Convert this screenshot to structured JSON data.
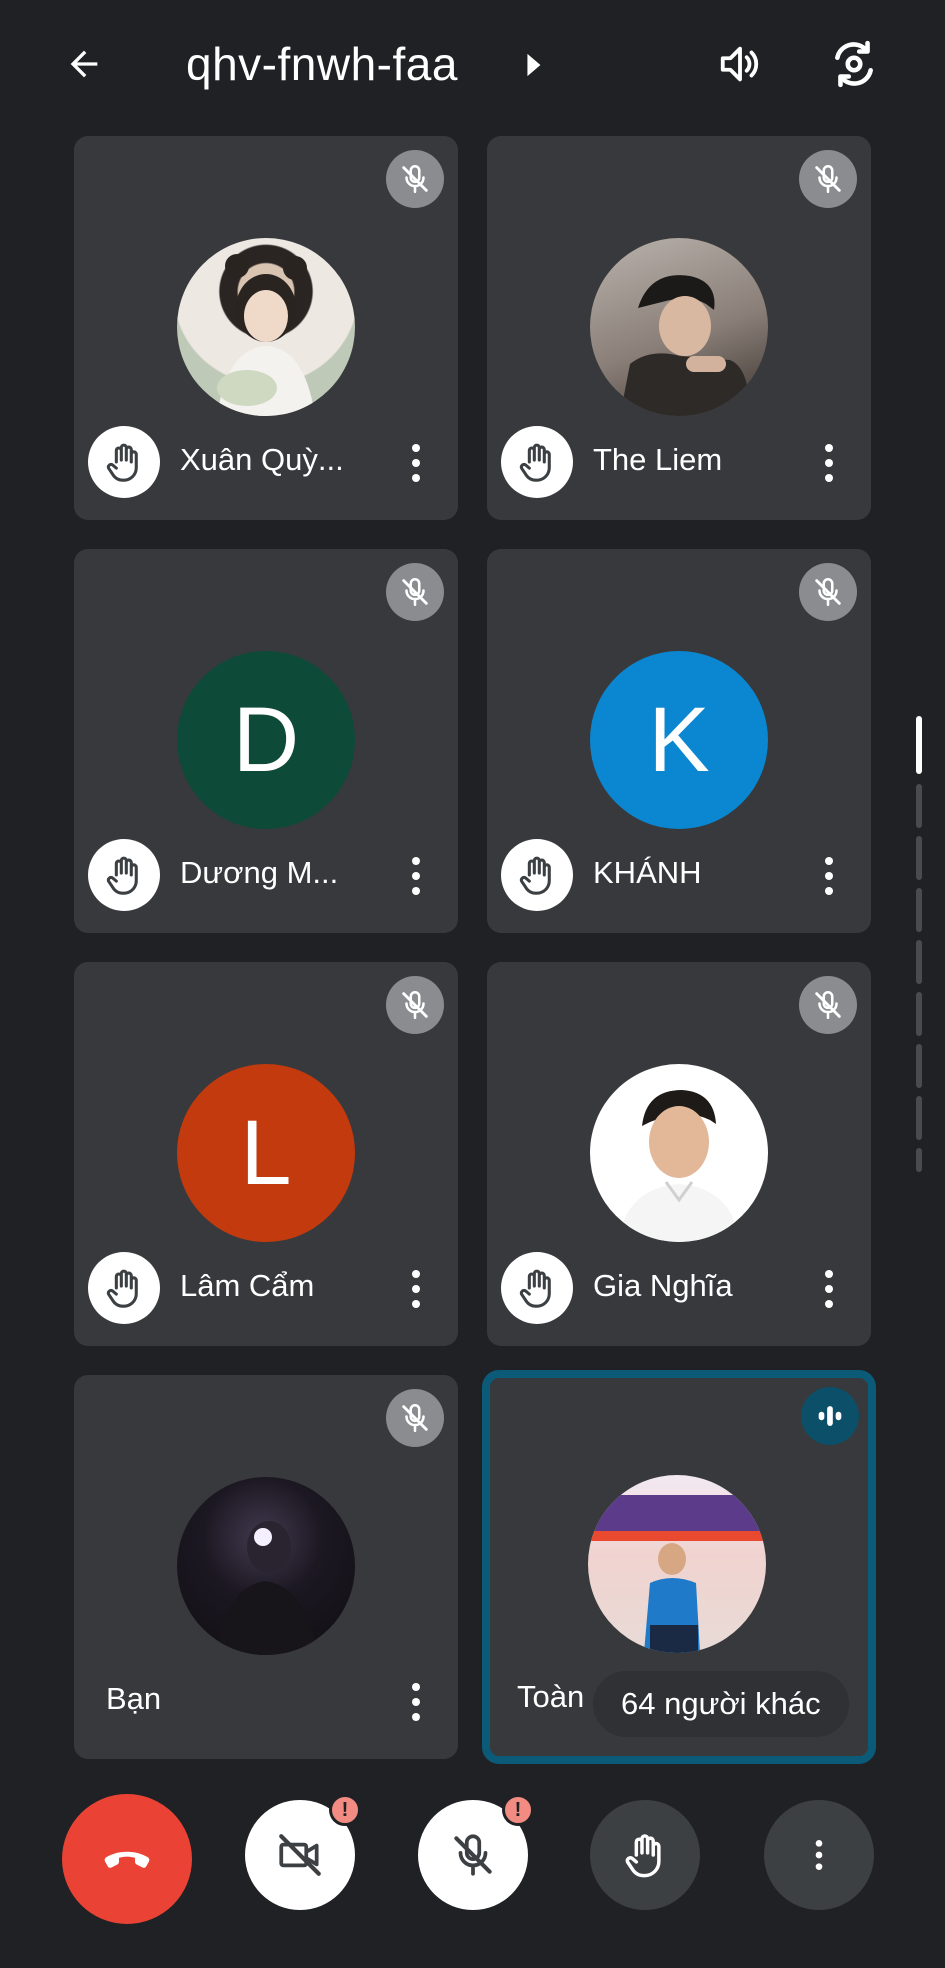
{
  "header": {
    "meeting_code": "qhv-fnwh-faa",
    "back_icon": "arrow-left-icon",
    "speaker_icon": "speaker-icon",
    "flip_icon": "camera-flip-icon"
  },
  "participants": [
    {
      "name": "Xuân Quỳ...",
      "avatar_type": "photo",
      "muted": true,
      "hand_raised": true
    },
    {
      "name": "The Liem",
      "avatar_type": "photo",
      "muted": true,
      "hand_raised": true
    },
    {
      "name": "Dương M...",
      "avatar_type": "letter",
      "letter": "D",
      "color": "#0d4a37",
      "muted": true,
      "hand_raised": true
    },
    {
      "name": "KHÁNH",
      "avatar_type": "letter",
      "letter": "K",
      "color": "#0b87d1",
      "muted": true,
      "hand_raised": true
    },
    {
      "name": "Lâm Cẩm",
      "avatar_type": "letter",
      "letter": "L",
      "color": "#c23a0e",
      "muted": true,
      "hand_raised": true
    },
    {
      "name": "Gia Nghĩa",
      "avatar_type": "photo",
      "muted": true,
      "hand_raised": true
    },
    {
      "name": "Bạn",
      "avatar_type": "photo",
      "muted": true,
      "hand_raised": false
    },
    {
      "name": "Toàn",
      "avatar_type": "photo",
      "muted": false,
      "speaking": true,
      "hand_raised": false
    }
  ],
  "others": {
    "label": "64 người khác"
  },
  "controls": {
    "end_call_icon": "phone-hangup-icon",
    "camera_icon": "camera-off-icon",
    "mic_icon": "mic-off-icon",
    "hand_icon": "raise-hand-icon",
    "more_icon": "more-vert-icon",
    "warning_mark": "!"
  },
  "colors": {
    "background": "#202124",
    "tile": "#38393c",
    "end_call": "#ea4335",
    "active_outline": "#0b5a78",
    "warning": "#f28b82"
  }
}
